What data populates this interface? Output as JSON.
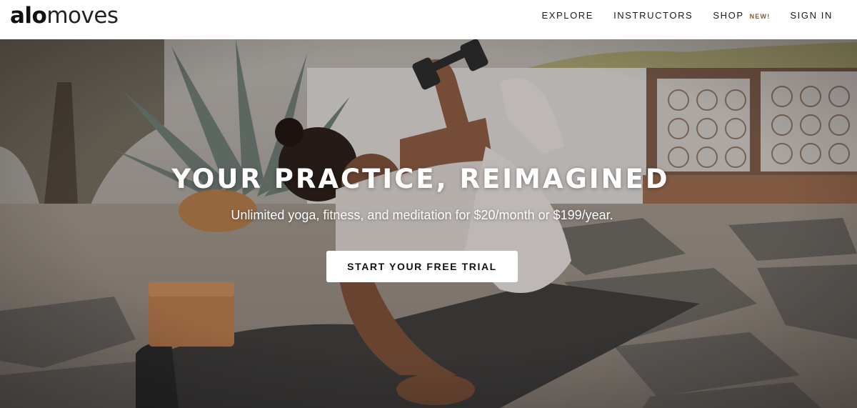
{
  "header": {
    "logo_bold": "alo",
    "logo_light": "moves",
    "nav": {
      "explore": "EXPLORE",
      "instructors": "INSTRUCTORS",
      "shop": "SHOP",
      "shop_badge": "NEW!",
      "sign_in": "SIGN IN"
    }
  },
  "hero": {
    "title": "YOUR PRACTICE, REIMAGINED",
    "subtitle": "Unlimited yoga, fitness, and meditation for $20/month or $199/year.",
    "cta_label": "START YOUR FREE TRIAL",
    "image_description_icon": "hero-photo"
  },
  "colors": {
    "header_bg": "#ffffff",
    "nav_text": "#1a1a1a",
    "badge": "#8a5a2b",
    "cta_bg": "#ffffff",
    "cta_text": "#111111",
    "hero_text": "#ffffff"
  }
}
